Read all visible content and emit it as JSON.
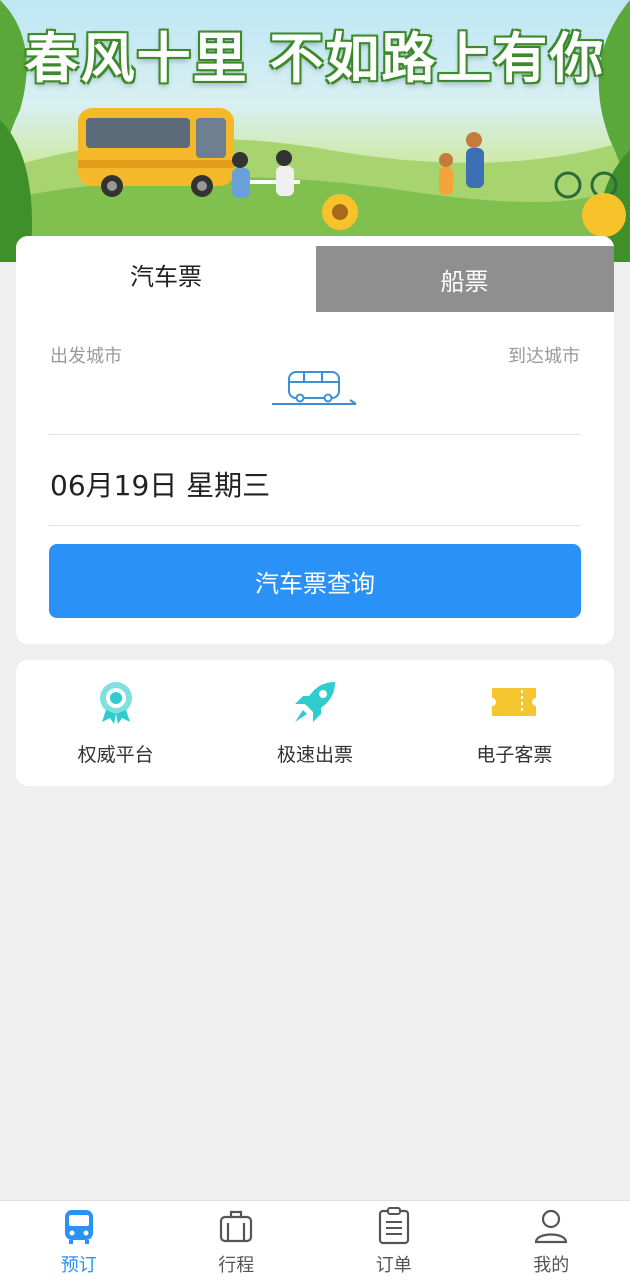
{
  "banner": {
    "title": "春风十里 不如路上有你"
  },
  "tabs": {
    "bus": "汽车票",
    "ship": "船票"
  },
  "search": {
    "from_city": "出发城市",
    "to_city": "到达城市",
    "date": "06月19日 星期三",
    "button": "汽车票查询"
  },
  "features": [
    {
      "label": "权威平台",
      "icon": "badge-icon"
    },
    {
      "label": "极速出票",
      "icon": "rocket-icon"
    },
    {
      "label": "电子客票",
      "icon": "ticket-icon"
    }
  ],
  "nav": [
    {
      "label": "预订",
      "icon": "bus-icon",
      "active": true
    },
    {
      "label": "行程",
      "icon": "luggage-icon"
    },
    {
      "label": "订单",
      "icon": "clipboard-icon"
    },
    {
      "label": "我的",
      "icon": "user-icon"
    }
  ],
  "colors": {
    "accent": "#2a92f6",
    "tab_inactive": "#8f8f8f",
    "feature_teal": "#2ecbcf",
    "feature_yellow": "#f6c631"
  }
}
